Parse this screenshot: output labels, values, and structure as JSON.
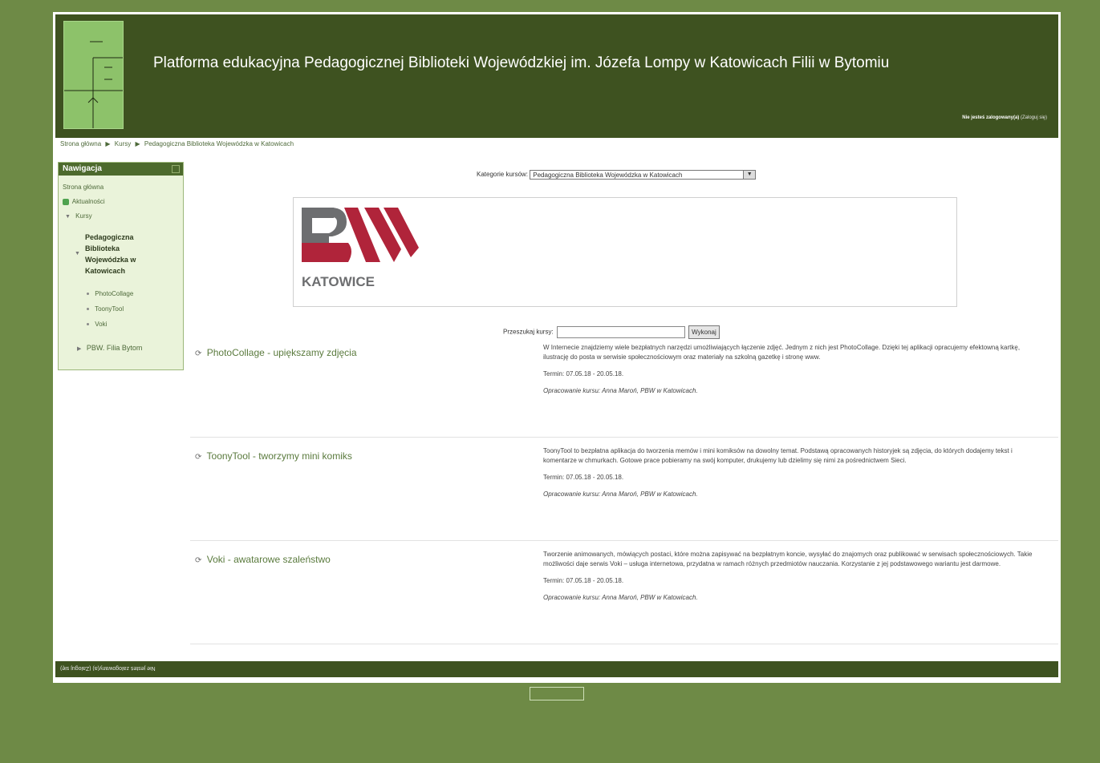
{
  "header": {
    "site_title": "Platforma edukacyjna Pedagogicznej Biblioteki Wojewódzkiej im. Józefa Lompy w Katowicach Filii w Bytomiu",
    "login_status": "Nie jesteś zalogowany(a)",
    "login_link": "(Zaloguj się)"
  },
  "breadcrumb": {
    "items": [
      "Strona główna",
      "Kursy",
      "Pedagogiczna Biblioteka Wojewódzka w Katowicach"
    ],
    "separator": "▶"
  },
  "navigation": {
    "title": "Nawigacja",
    "home": "Strona główna",
    "news": "Aktualności",
    "courses": "Kursy",
    "category": "Pedagogiczna Biblioteka Wojewódzka w Katowicach",
    "sub_items": [
      "PhotoCollage",
      "ToonyTool",
      "Voki"
    ],
    "branch": "PBW. Filia Bytom"
  },
  "category_select": {
    "label": "Kategorie kursów:",
    "selected": "Pedagogiczna Biblioteka Wojewódzka w Katowicach"
  },
  "banner": {
    "logo_letters": "BW",
    "logo_city": "KATOWICE"
  },
  "search": {
    "label": "Przeszukaj kursy:",
    "value": "",
    "button": "Wykonaj"
  },
  "courses": [
    {
      "title": "PhotoCollage - upiększamy zdjęcia",
      "description": "W Internecie znajdziemy wiele bezpłatnych narzędzi umożliwiających łączenie zdjęć. Jednym z nich jest PhotoCollage. Dzięki tej aplikacji opracujemy efektowną kartkę, ilustrację do posta w serwisie społecznościowym oraz materiały na szkolną gazetkę i stronę www.",
      "term": "Termin: 07.05.18 - 20.05.18.",
      "author": "Opracowanie kursu: Anna Maroń, PBW w Katowicach."
    },
    {
      "title": "ToonyTool - tworzymy mini komiks",
      "description": "ToonyTool to bezpłatna aplikacja do tworzenia memów i mini komiksów na dowolny temat. Podstawą opracowanych historyjek są zdjęcia, do których dodajemy tekst i komentarze w chmurkach. Gotowe prace pobieramy na swój komputer, drukujemy lub dzielimy się nimi za pośrednictwem Sieci.",
      "term": "Termin: 07.05.18 - 20.05.18.",
      "author": "Opracowanie kursu: Anna Maroń, PBW w Katowicach."
    },
    {
      "title": "Voki - awatarowe szaleństwo",
      "description": "Tworzenie animowanych, mówiących postaci, które można zapisywać na bezpłatnym koncie, wysyłać do znajomych oraz publikować w serwisach społecznościowych. Takie możliwości daje serwis Voki – usługa internetowa, przydatna w ramach różnych przedmiotów nauczania. Korzystanie z jej podstawowego wariantu jest darmowe.",
      "term": "Termin: 07.05.18 - 20.05.18.",
      "author": "Opracowanie kursu: Anna Maroń, PBW w Katowicach."
    }
  ],
  "footer": {
    "login_status": "Nie jesteś zalogowany(a)",
    "login_link": "(Zaloguj się)"
  },
  "colors": {
    "background": "#6e8a46",
    "header": "#3e5220",
    "logo_red": "#b0243a",
    "logo_gray": "#6d6e70"
  }
}
